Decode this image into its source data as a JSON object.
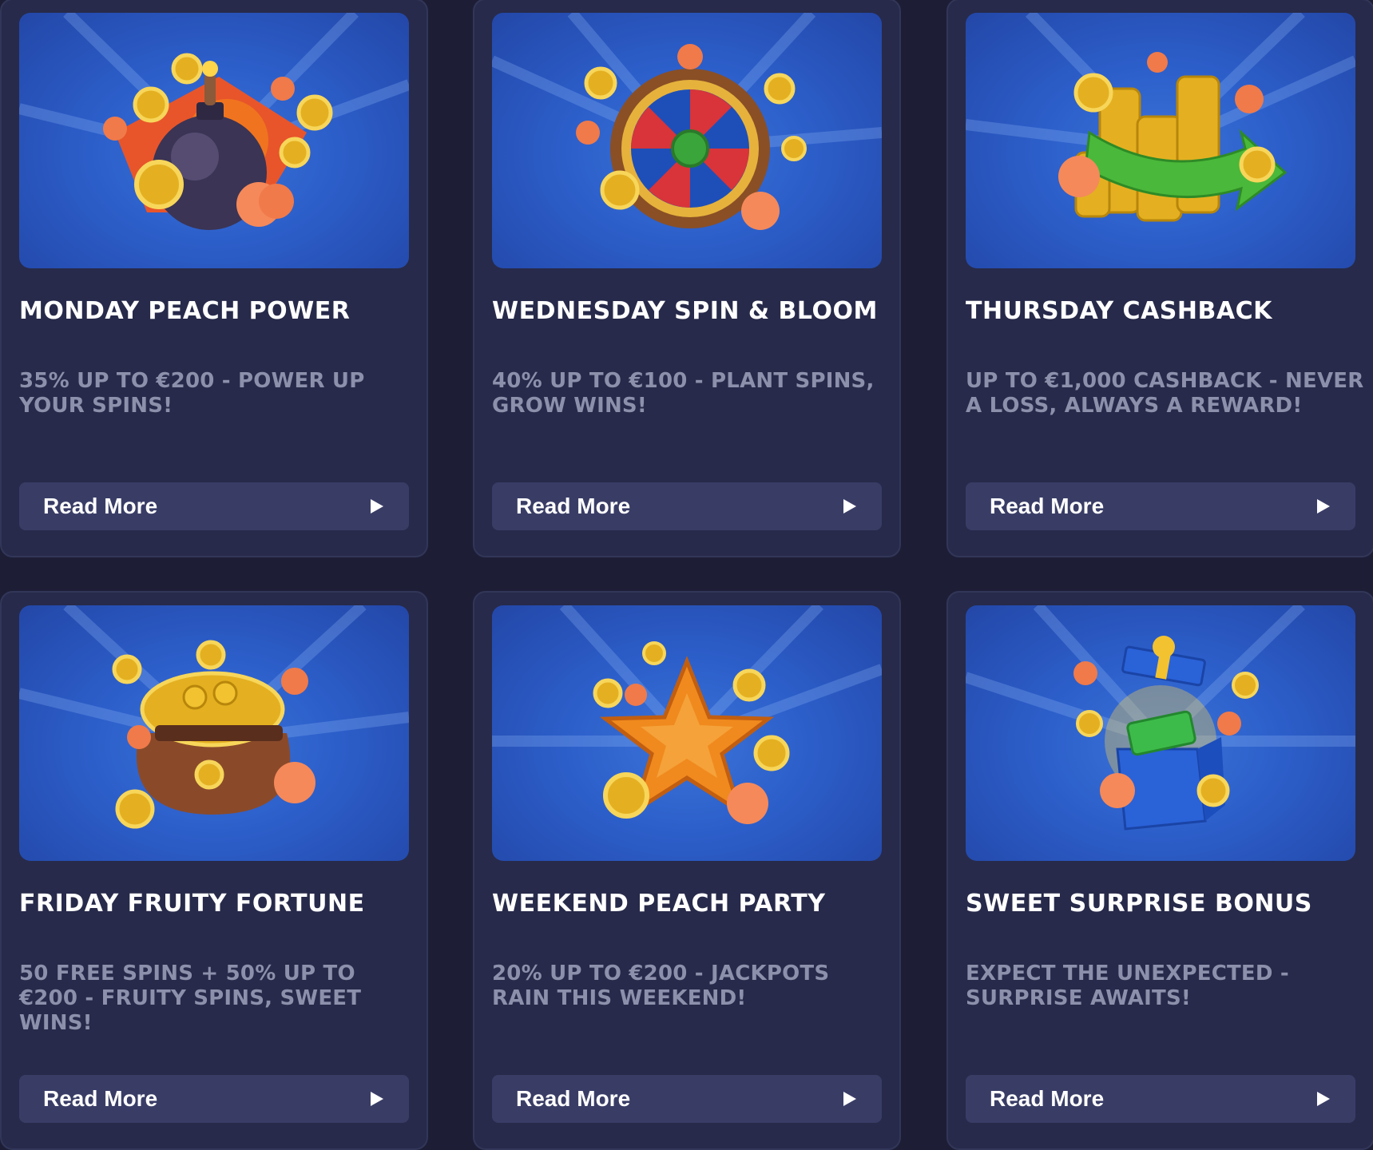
{
  "promotions": [
    {
      "title": "MONDAY PEACH POWER",
      "description": "35% UP TO €200 - POWER UP YOUR SPINS!",
      "button_label": "Read More",
      "artwork": "bomb-with-coins-and-peaches"
    },
    {
      "title": "WEDNESDAY SPIN & BLOOM",
      "description": "40% UP TO €100 - PLANT SPINS, GROW WINS!",
      "button_label": "Read More",
      "artwork": "prize-wheel-with-coins-and-peaches"
    },
    {
      "title": "THURSDAY CASHBACK",
      "description": "UP TO €1,000 CASHBACK - NEVER A LOSS, ALWAYS A REWARD!",
      "button_label": "Read More",
      "artwork": "coin-stacks-with-green-arrow"
    },
    {
      "title": "FRIDAY FRUITY FORTUNE",
      "description": "50 FREE SPINS + 50% UP TO €200 - FRUITY SPINS, SWEET WINS!",
      "button_label": "Read More",
      "artwork": "sack-of-gold-coins"
    },
    {
      "title": "WEEKEND PEACH PARTY",
      "description": "20% UP TO €200 - JACKPOTS RAIN THIS WEEKEND!",
      "button_label": "Read More",
      "artwork": "orange-star-with-coins"
    },
    {
      "title": "SWEET SURPRISE BONUS",
      "description": "EXPECT THE UNEXPECTED - SURPRISE AWAITS!",
      "button_label": "Read More",
      "artwork": "gift-box-with-cash"
    }
  ],
  "colors": {
    "page_background": "#1d1e36",
    "card_background": "#272a4a",
    "card_border": "#323658",
    "button_background": "#393d66",
    "title_text": "#ffffff",
    "description_text": "#8d90ab",
    "banner_blue": "#2c5ec9",
    "coin_gold": "#f2c230",
    "peach": "#f07a4a"
  },
  "icons": {
    "button_icon": "play-icon"
  }
}
